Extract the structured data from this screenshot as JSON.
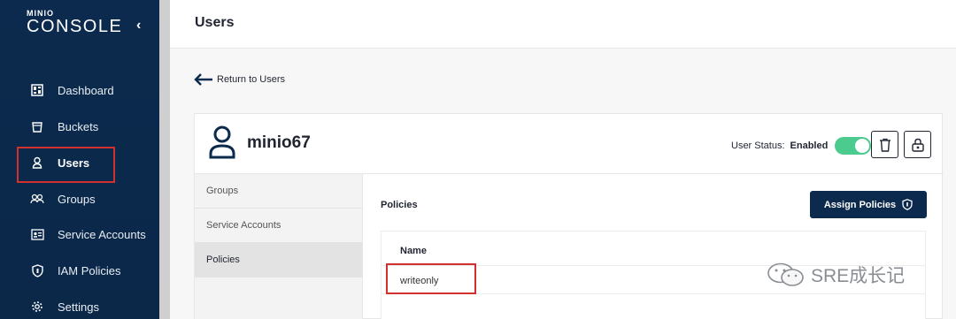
{
  "sidebar": {
    "logo_small": "MINIO",
    "logo_big": "CONSOLE",
    "items": [
      {
        "label": "Dashboard",
        "icon": "dashboard-icon"
      },
      {
        "label": "Buckets",
        "icon": "bucket-icon"
      },
      {
        "label": "Users",
        "icon": "user-icon",
        "active": true
      },
      {
        "label": "Groups",
        "icon": "groups-icon"
      },
      {
        "label": "Service Accounts",
        "icon": "service-accounts-icon"
      },
      {
        "label": "IAM Policies",
        "icon": "shield-icon"
      },
      {
        "label": "Settings",
        "icon": "gear-icon"
      }
    ]
  },
  "header": {
    "title": "Users"
  },
  "back": {
    "label": "Return to Users"
  },
  "user": {
    "name": "minio67",
    "status_label": "User Status:",
    "status_value": "Enabled",
    "enabled": true
  },
  "menu": {
    "items": [
      "Groups",
      "Service Accounts",
      "Policies"
    ],
    "active": "Policies"
  },
  "policies": {
    "title": "Policies",
    "assign_label": "Assign Policies",
    "column_name": "Name",
    "rows": [
      "writeonly"
    ]
  },
  "watermark": {
    "text": "SRE成长记"
  },
  "colors": {
    "sidebar": "#0b2a4d",
    "toggle_on": "#4ccb8f",
    "highlight": "#d22f2f"
  }
}
